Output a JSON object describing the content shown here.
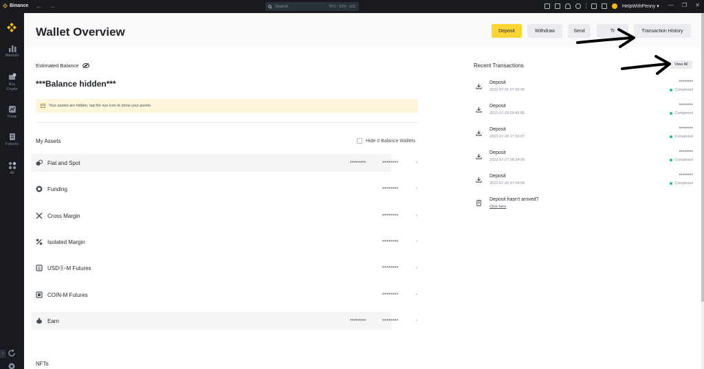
{
  "titlebar": {
    "app_name": "Binance",
    "back_glyph": "←",
    "forward_glyph": "→",
    "search_placeholder": "Search",
    "search_hints": "BTC · ETH · SOL",
    "username": "HelpWithPenny",
    "username_caret": "▾",
    "minimize_glyph": "—",
    "restore_glyph": "❐",
    "close_glyph": "✕"
  },
  "sidebar": {
    "items": [
      {
        "label": "Markets",
        "icon": "bar-chart-icon"
      },
      {
        "label": "Buy Crypto",
        "icon": "wallet-coin-icon"
      },
      {
        "label": "Trade",
        "icon": "trade-icon"
      },
      {
        "label": "Futures",
        "icon": "futures-icon"
      },
      {
        "label": "All",
        "icon": "grid-icon"
      }
    ],
    "expand_glyph": "‹"
  },
  "header": {
    "title": "Wallet Overview",
    "buttons": {
      "deposit": "Deposit",
      "withdraw": "Withdraw",
      "send": "Send",
      "transfer": "Tr",
      "history": "Transaction History"
    }
  },
  "balance": {
    "label": "Estimated Balance",
    "value": "***Balance hidden***",
    "notice": "Your assets are hidden, tap the eye icon to show your assets."
  },
  "assets": {
    "title": "My Assets",
    "hide_zero_label": "Hide 0 Balance Wallets",
    "rows": [
      {
        "name": "Fiat and Spot",
        "mask1": "********",
        "mask2": "********",
        "chevron": "›"
      },
      {
        "name": "Funding",
        "mask1": "",
        "mask2": "********",
        "chevron": "›"
      },
      {
        "name": "Cross Margin",
        "mask1": "",
        "mask2": "********",
        "chevron": "›"
      },
      {
        "name": "Isolated Margin",
        "mask1": "",
        "mask2": "********",
        "chevron": "›"
      },
      {
        "name": "USDⓈ-M Futures",
        "mask1": "",
        "mask2": "********",
        "chevron": "›"
      },
      {
        "name": "COIN-M Futures",
        "mask1": "",
        "mask2": "********",
        "chevron": "›"
      },
      {
        "name": "Earn",
        "mask1": "********",
        "mask2": "********",
        "chevron": "›"
      }
    ],
    "nfts_label": "NFTs"
  },
  "recent": {
    "title": "Recent Transactions",
    "view_all": "View All",
    "transactions": [
      {
        "title": "Deposit",
        "date": "2022-07-31 07:36:05",
        "amount": "********",
        "status": "Completed"
      },
      {
        "title": "Deposit",
        "date": "2022-07-29 09:42:05",
        "amount": "********",
        "status": "Completed"
      },
      {
        "title": "Deposit",
        "date": "2022-07-28 17:26:07",
        "amount": "********",
        "status": "Completed"
      },
      {
        "title": "Deposit",
        "date": "2022-07-27 08:34:09",
        "amount": "********",
        "status": "Completed"
      },
      {
        "title": "Deposit",
        "date": "2022-07-26 07:04:04",
        "amount": "********",
        "status": "Completed"
      }
    ],
    "help_title": "Deposit hasn't arrived?",
    "help_link": "Click here"
  },
  "colors": {
    "brand": "#f0b90b",
    "primary_button": "#fcd535",
    "completed": "#0ecb81",
    "dark": "#181a20"
  }
}
